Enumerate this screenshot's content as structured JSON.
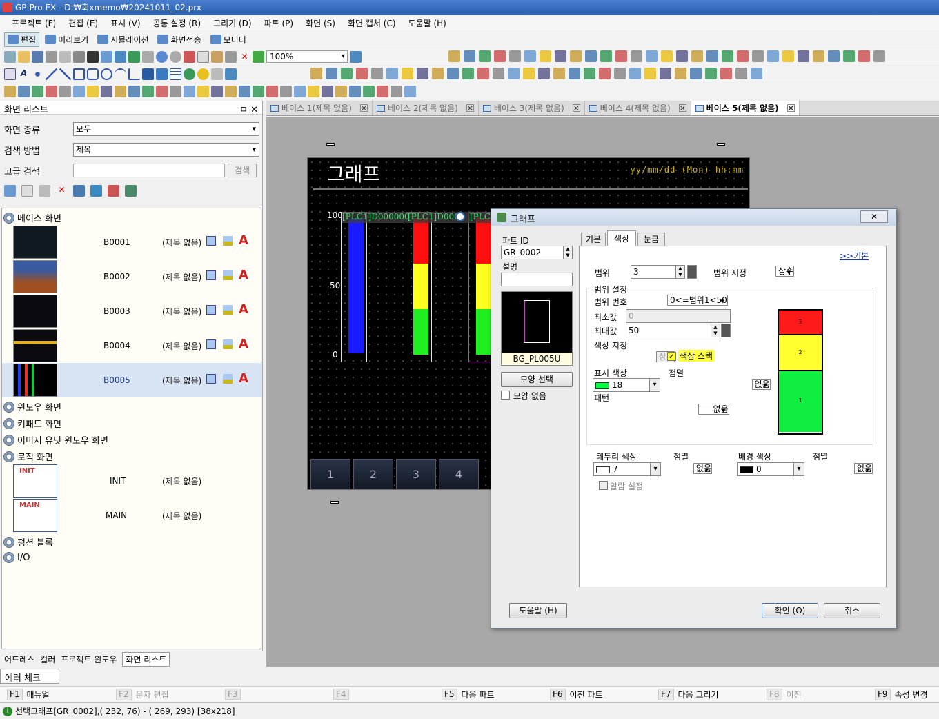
{
  "app": {
    "title": "GP-Pro EX - D:₩회xmemo₩20241011_02.prx"
  },
  "menu": [
    "프로젝트 (F)",
    "편집 (E)",
    "표시 (V)",
    "공통 설정 (R)",
    "그리기 (D)",
    "파트 (P)",
    "화면 (S)",
    "화면 캡처 (C)",
    "도움말 (H)"
  ],
  "modes": [
    "편집",
    "미리보기",
    "시뮬레이션",
    "화면전송",
    "모니터"
  ],
  "zoom": "100%",
  "left_panel": {
    "title": "화면 리스트",
    "pin": "ㅁ",
    "close": "✕",
    "screen_type_label": "화면 종류",
    "screen_type_value": "모두",
    "search_method_label": "검색 방법",
    "search_method_value": "제목",
    "adv_search_label": "고급 검색",
    "search_button": "검색",
    "tree": {
      "base": "베이스 화면",
      "window": "윈도우 화면",
      "keypad": "키패드 화면",
      "image_unit": "이미지 유닛 윈도우 화면",
      "logic": "로직 화면",
      "function_block": "펑션 블록",
      "io": "I/O"
    },
    "screens": [
      {
        "id": "B0001",
        "title": "(제목 없음)"
      },
      {
        "id": "B0002",
        "title": "(제목 없음)"
      },
      {
        "id": "B0003",
        "title": "(제목 없음)"
      },
      {
        "id": "B0004",
        "title": "(제목 없음)"
      },
      {
        "id": "B0005",
        "title": "(제목 없음)"
      }
    ],
    "logic_screens": [
      {
        "id": "INIT",
        "title": "(제목 없음)",
        "thumb_label": "INIT"
      },
      {
        "id": "MAIN",
        "title": "(제목 없음)",
        "thumb_label": "MAIN"
      }
    ],
    "bottom_tabs": [
      "어드레스",
      "컬러",
      "프로젝트 윈도우",
      "화면 리스트"
    ]
  },
  "error_tab": "에러 체크",
  "doc_tabs": [
    "베이스 1(제목 없음)",
    "베이스 2(제목 없음)",
    "베이스 3(제목 없음)",
    "베이스 4(제목 없음)",
    "베이스 5(제목 없음)"
  ],
  "canvas": {
    "title": "그래프",
    "date": "yy/mm/dd (Mon) hh:mm",
    "yticks": [
      "100",
      "50",
      "0"
    ],
    "address_label": "[PLC1]D000000",
    "address_label2": "[PLC1]D000",
    "address_label3": "[PLC",
    "func_keys": [
      "1",
      "2",
      "3",
      "4"
    ]
  },
  "dialog": {
    "title": "그래프",
    "close": "✕",
    "part_id_label": "파트 ID",
    "part_id": "GR_0002",
    "desc_label": "설명",
    "preview_label": "BG_PL005U",
    "shape_select": "모양 선택",
    "no_shape": "모양 없음",
    "tabs": [
      "기본",
      "색상",
      "눈금"
    ],
    "basic_link": ">>기본",
    "range_label": "범위",
    "range_value": "3",
    "range_spec_label": "범위 지정",
    "range_spec_value": "상수",
    "range_setting": "범위 설정",
    "range_no_label": "범위 번호",
    "range_no_value": "0<=범위1<50",
    "min_label": "최소값",
    "min_value": "0",
    "max_label": "최대값",
    "max_value": "50",
    "color_spec_label": "색상 지정",
    "color_spec_value": "상수",
    "color_stack": "색상 스택",
    "display_color_label": "표시 색상",
    "display_color_value": "18",
    "blink_label": "점멸",
    "blink_value": "없음",
    "pattern_label": "패턴",
    "pattern_value": "없음",
    "border_color_label": "테두리 색상",
    "border_color_value": "7",
    "border_blink_value": "없음",
    "bg_color_label": "배경 색상",
    "bg_color_value": "0",
    "bg_blink_value": "없음",
    "alarm": "알람 설정",
    "stack_labels": [
      "3",
      "2",
      "1"
    ],
    "help": "도움말 (H)",
    "ok": "확인 (O)",
    "cancel": "취소",
    "colors": {
      "red": "#ff0000",
      "yellow": "#ffff00",
      "green": "#00ff00",
      "highlight": "#ffff40"
    }
  },
  "fkeys": [
    {
      "key": "F1",
      "label": "매뉴얼"
    },
    {
      "key": "F2",
      "label": "문자 편집"
    },
    {
      "key": "F3",
      "label": ""
    },
    {
      "key": "F4",
      "label": ""
    },
    {
      "key": "F5",
      "label": "다음 파트"
    },
    {
      "key": "F6",
      "label": "이전 파트"
    },
    {
      "key": "F7",
      "label": "다음 그리기"
    },
    {
      "key": "F8",
      "label": "이전"
    },
    {
      "key": "F9",
      "label": "속성 변경"
    }
  ],
  "status": "선택그래프[GR_0002],( 232,  76) - ( 269, 293) [38x218]"
}
